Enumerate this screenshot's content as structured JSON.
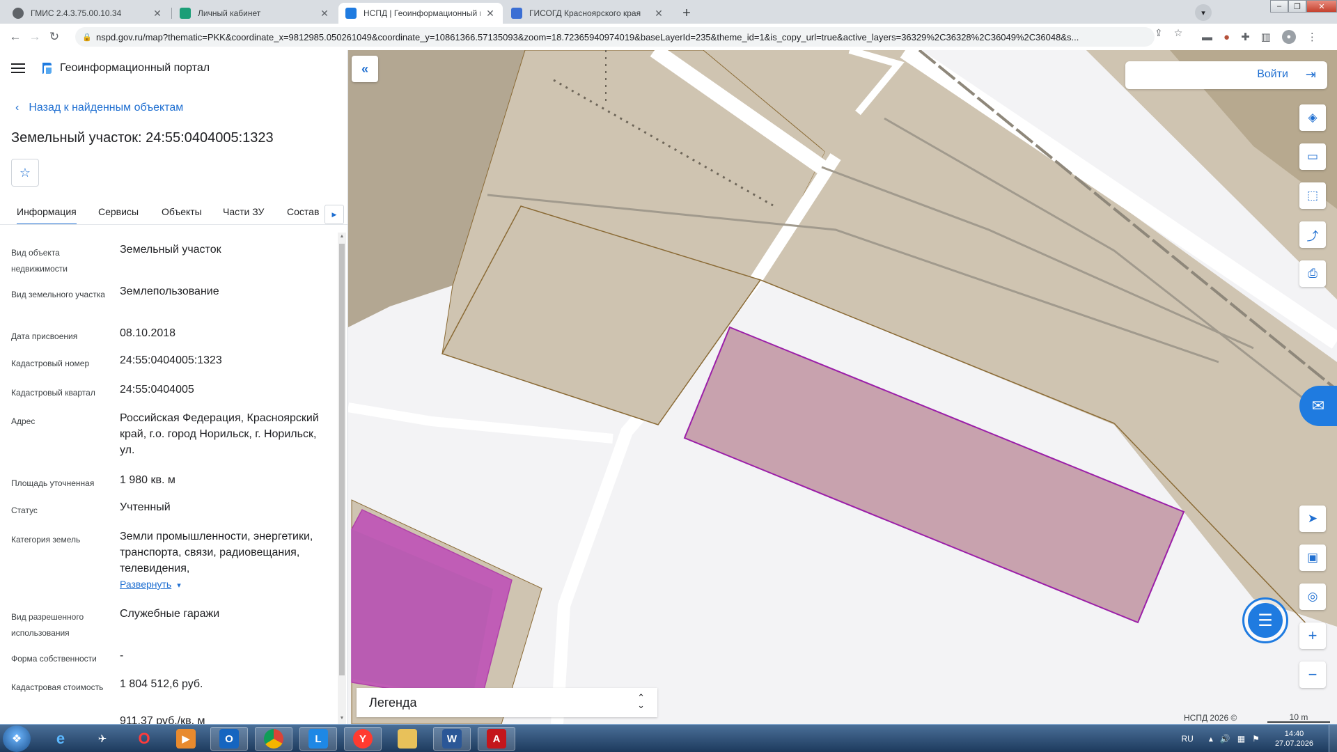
{
  "browser": {
    "tabs": [
      {
        "title": "ГМИС 2.4.3.75.00.10.34",
        "favicon_color": "#5f6368",
        "active": false
      },
      {
        "title": "Личный кабинет",
        "favicon_color": "#1b9e77",
        "active": false
      },
      {
        "title": "НСПД | Геоинформационный п",
        "favicon_color": "#1f7be0",
        "active": true
      },
      {
        "title": "ГИСОГД Красноярского края",
        "favicon_color": "#3b6fd4",
        "active": false
      }
    ],
    "new_tab": "+",
    "url": "nspd.gov.ru/map?thematic=PKK&coordinate_x=9812985.050261049&coordinate_y=10861366.57135093&zoom=18.72365940974019&baseLayerId=235&theme_id=1&is_copy_url=true&active_layers=36329%2C36328%2C36049%2C36048&s..."
  },
  "sidebar": {
    "portal_title": "Геоинформационный портал",
    "back_label": "Назад к найденным объектам",
    "object_title": "Земельный участок: 24:55:0404005:1323",
    "tabs": [
      "Информация",
      "Сервисы",
      "Объекты",
      "Части ЗУ",
      "Состав"
    ],
    "props": [
      {
        "key": "Вид объекта недвижимости",
        "value": "Земельный участок"
      },
      {
        "key": "Вид земельного участка",
        "value": "Землепользование"
      },
      {
        "key": "Дата присвоения",
        "value": "08.10.2018"
      },
      {
        "key": "Кадастровый номер",
        "value": "24:55:0404005:1323"
      },
      {
        "key": "Кадастровый квартал",
        "value": "24:55:0404005"
      },
      {
        "key": "Адрес",
        "value": "Российская Федерация, Красноярский край, г.о. город Норильск, г. Норильск, ул."
      },
      {
        "key": "Площадь уточненная",
        "value": "1 980 кв. м"
      },
      {
        "key": "Статус",
        "value": "Учтенный"
      },
      {
        "key": "Категория земель",
        "value": "Земли промышленности, энергетики, транспорта, связи, радиовещания, телевидения,"
      },
      {
        "key": "Вид разрешенного использования",
        "value": "Служебные гаражи"
      },
      {
        "key": "Форма собственности",
        "value": "-"
      },
      {
        "key": "Кадастровая стоимость",
        "value": "1 804 512,6 руб."
      },
      {
        "key": "",
        "value": "911,37 руб./кв. м"
      }
    ],
    "expand_label": "Развернуть"
  },
  "map": {
    "login_label": "Войти",
    "legend_label": "Легенда",
    "copyright": "НСПД 2026 ©",
    "scale_label": "10 m",
    "colors": {
      "parcel_fill": "#cfc4b1",
      "parcel_stroke": "#8a6a35",
      "selected_fill": "#c8a2ae",
      "selected_stroke": "#9b1fa8",
      "magenta_fill": "#c05db6",
      "accent": "#1f7be0"
    }
  },
  "taskbar": {
    "lang": "RU",
    "time": "14:40",
    "date": "27.07.2026"
  }
}
